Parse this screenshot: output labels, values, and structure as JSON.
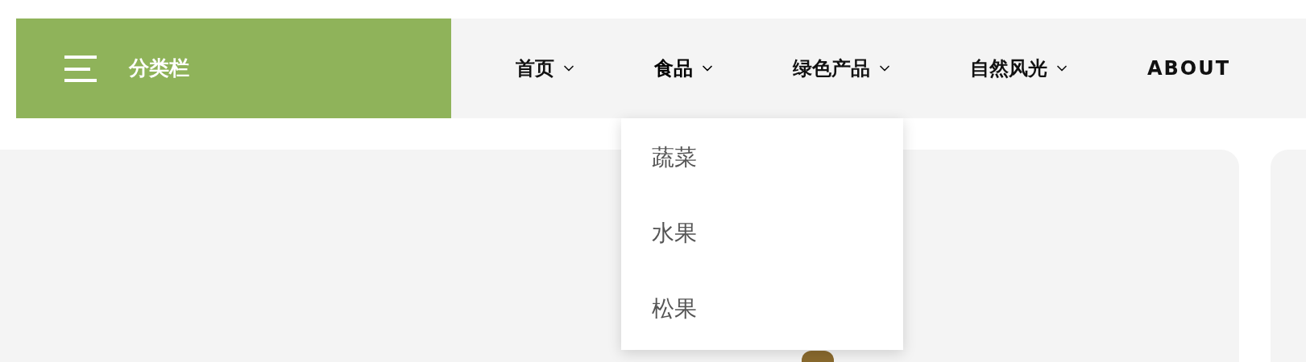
{
  "category_bar": {
    "label": "分类栏"
  },
  "nav": [
    {
      "label": "首页",
      "has_dropdown": true,
      "expanded": false
    },
    {
      "label": "食品",
      "has_dropdown": true,
      "expanded": true,
      "menu": [
        "蔬菜",
        "水果",
        "松果"
      ]
    },
    {
      "label": "绿色产品",
      "has_dropdown": true,
      "expanded": false
    },
    {
      "label": "自然风光",
      "has_dropdown": true,
      "expanded": false
    },
    {
      "label": "ABOUT",
      "has_dropdown": false,
      "expanded": false
    }
  ]
}
